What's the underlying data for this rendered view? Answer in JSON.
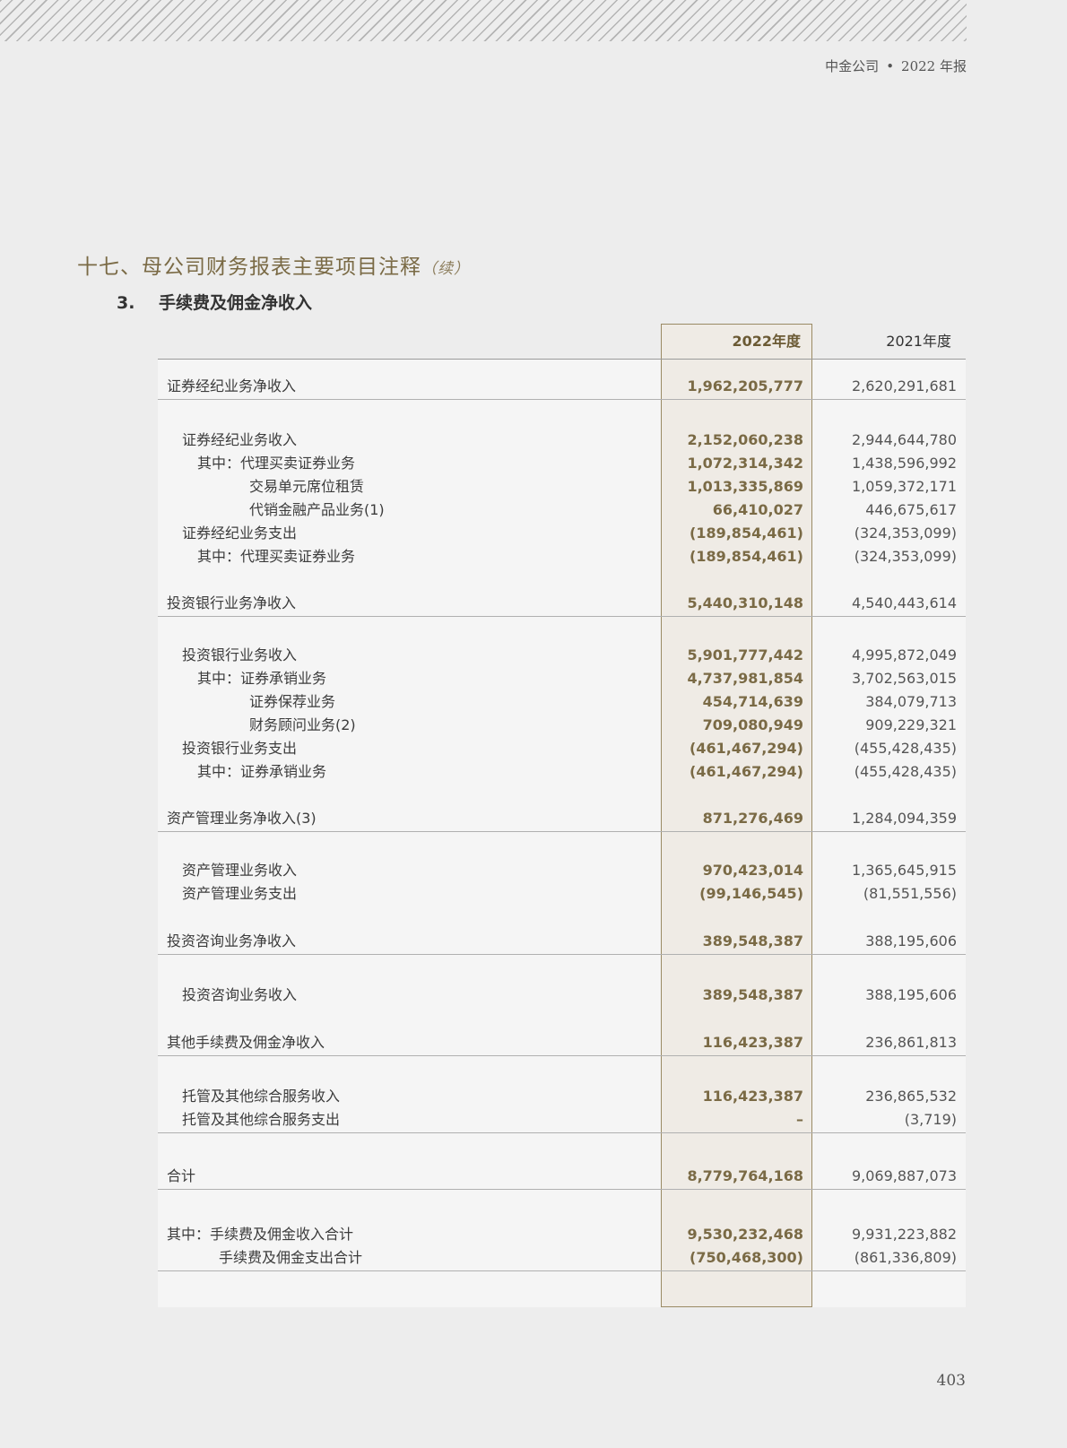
{
  "header": {
    "company": "中金公司",
    "year_report": "2022 年报"
  },
  "section": {
    "title": "十七、母公司财务报表主要项目注释",
    "continued": "（续）"
  },
  "subsection": {
    "number": "3.",
    "title": "手续费及佣金净收入"
  },
  "table": {
    "columns": [
      "2022年度",
      "2021年度"
    ],
    "rows": [
      {
        "label": "证券经纪业务净收入",
        "v2022": "1,962,205,777",
        "v2021": "2,620,291,681"
      },
      {
        "label": "证券经纪业务收入",
        "v2022": "2,152,060,238",
        "v2021": "2,944,644,780"
      },
      {
        "label": "其中：代理买卖证券业务",
        "v2022": "1,072,314,342",
        "v2021": "1,438,596,992"
      },
      {
        "label": "交易单元席位租赁",
        "v2022": "1,013,335,869",
        "v2021": "1,059,372,171"
      },
      {
        "label": "代销金融产品业务(1)",
        "v2022": "66,410,027",
        "v2021": "446,675,617"
      },
      {
        "label": "证券经纪业务支出",
        "v2022": "(189,854,461)",
        "v2021": "(324,353,099)"
      },
      {
        "label": "其中：代理买卖证券业务",
        "v2022": "(189,854,461)",
        "v2021": "(324,353,099)"
      },
      {
        "label": "投资银行业务净收入",
        "v2022": "5,440,310,148",
        "v2021": "4,540,443,614"
      },
      {
        "label": "投资银行业务收入",
        "v2022": "5,901,777,442",
        "v2021": "4,995,872,049"
      },
      {
        "label": "其中：证券承销业务",
        "v2022": "4,737,981,854",
        "v2021": "3,702,563,015"
      },
      {
        "label": "证券保荐业务",
        "v2022": "454,714,639",
        "v2021": "384,079,713"
      },
      {
        "label": "财务顾问业务(2)",
        "v2022": "709,080,949",
        "v2021": "909,229,321"
      },
      {
        "label": "投资银行业务支出",
        "v2022": "(461,467,294)",
        "v2021": "(455,428,435)"
      },
      {
        "label": "其中：证券承销业务",
        "v2022": "(461,467,294)",
        "v2021": "(455,428,435)"
      },
      {
        "label": "资产管理业务净收入(3)",
        "v2022": "871,276,469",
        "v2021": "1,284,094,359"
      },
      {
        "label": "资产管理业务收入",
        "v2022": "970,423,014",
        "v2021": "1,365,645,915"
      },
      {
        "label": "资产管理业务支出",
        "v2022": "(99,146,545)",
        "v2021": "(81,551,556)"
      },
      {
        "label": "投资咨询业务净收入",
        "v2022": "389,548,387",
        "v2021": "388,195,606"
      },
      {
        "label": "投资咨询业务收入",
        "v2022": "389,548,387",
        "v2021": "388,195,606"
      },
      {
        "label": "其他手续费及佣金净收入",
        "v2022": "116,423,387",
        "v2021": "236,861,813"
      },
      {
        "label": "托管及其他综合服务收入",
        "v2022": "116,423,387",
        "v2021": "236,865,532"
      },
      {
        "label": "托管及其他综合服务支出",
        "v2022": "–",
        "v2021": "(3,719)"
      },
      {
        "label": "合计",
        "v2022": "8,779,764,168",
        "v2021": "9,069,887,073"
      },
      {
        "label": "其中：手续费及佣金收入合计",
        "v2022": "9,530,232,468",
        "v2021": "9,931,223,882"
      },
      {
        "label": "手续费及佣金支出合计",
        "v2022": "(750,468,300)",
        "v2021": "(861,336,809)"
      }
    ]
  },
  "page_number": "403"
}
